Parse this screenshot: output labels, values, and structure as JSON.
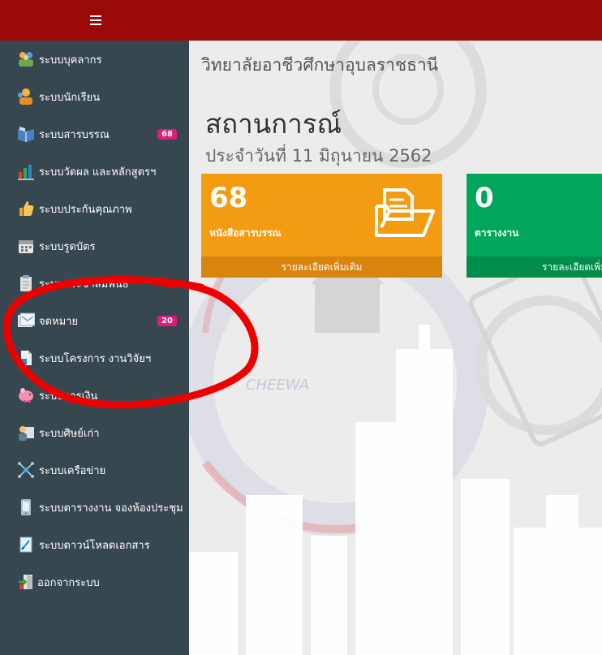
{
  "header": {
    "menu_icon": "hamburger-icon",
    "color": "#9a0a08"
  },
  "sidebar": {
    "items": [
      {
        "label": "ระบบบุคลากร",
        "icon": "people-group-icon"
      },
      {
        "label": "ระบบนักเรียน",
        "icon": "students-icon"
      },
      {
        "label": "ระบบสารบรรณ",
        "icon": "open-book-icon",
        "badge": "68"
      },
      {
        "label": "ระบบวัดผล และหลักสูตรฯ",
        "icon": "chart-icon"
      },
      {
        "label": "ระบบประกันคุณภาพ",
        "icon": "thumbs-up-icon"
      },
      {
        "label": "ระบบรูดบัตร",
        "icon": "calendar-icon"
      },
      {
        "label": "ระบบประชาสัมพันธ์",
        "icon": "clipboard-icon"
      },
      {
        "label": "จดหมาย",
        "icon": "mail-icon",
        "badge": "20"
      },
      {
        "label": "ระบบโครงการ งานวิจัยฯ",
        "icon": "document-icon"
      },
      {
        "label": "ระบบการเงิน",
        "icon": "piggy-bank-icon"
      },
      {
        "label": "ระบบศิษย์เก่า",
        "icon": "alumni-icon"
      },
      {
        "label": "ระบบเครือข่าย",
        "icon": "network-icon"
      },
      {
        "label": "ระบบตารางงาน จองห้องประชุม",
        "icon": "phone-icon"
      },
      {
        "label": "ระบบดาวน์โหลดเอกสาร",
        "icon": "download-doc-icon"
      },
      {
        "label": "ออกจากระบบ",
        "icon": "logout-icon"
      }
    ]
  },
  "main": {
    "college_name": "วิทยาลัยอาชีวศึกษาอุบลราชธานี",
    "title": "สถานการณ์",
    "date": "ประจำวันที่ 11 มิถุนายน 2562",
    "watermark_text": "CHEEWA",
    "cards": [
      {
        "value": "68",
        "label": "หนังสือสารบรรณ",
        "footer": "รายละเอียดเพิ่มเติม",
        "color": "#f39c12",
        "icon": "folder-document-icon"
      },
      {
        "value": "0",
        "label": "ตารางงาน",
        "footer": "รายละเอียดเพิ่มเติม",
        "color": "#00a65a"
      }
    ]
  },
  "annotation": {
    "shape": "red-hand-drawn-circle",
    "color": "#ee0000"
  }
}
